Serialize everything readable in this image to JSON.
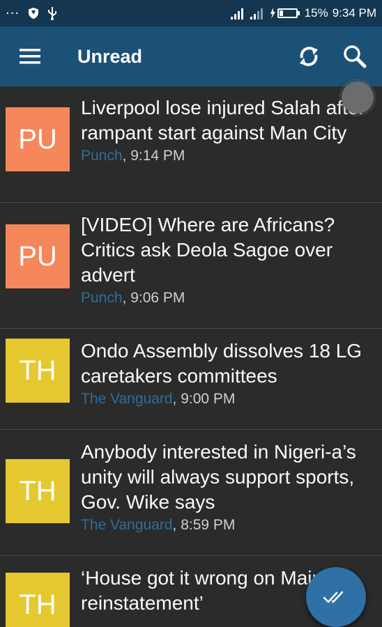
{
  "status_bar": {
    "battery": "15%",
    "time": "9:34 PM"
  },
  "app_bar": {
    "title": "Unread"
  },
  "articles": [
    {
      "avatar": "PU",
      "avatar_color": "#f5875a",
      "headline": "Liverpool lose injured Salah after rampant start against Man City",
      "source": "Punch",
      "time": ", 9:14 PM"
    },
    {
      "avatar": "PU",
      "avatar_color": "#f5875a",
      "headline": "[VIDEO] Where are Africans? Critics ask Deola Sagoe over advert",
      "source": "Punch",
      "time": ", 9:06 PM"
    },
    {
      "avatar": "TH",
      "avatar_color": "#e5c830",
      "headline": "Ondo Assembly dissolves 18 LG caretakers committees",
      "source": "The Vanguard",
      "time": ", 9:00 PM"
    },
    {
      "avatar": "TH",
      "avatar_color": "#e5c830",
      "headline": "Anybody interested in Nigeri-a’s unity will always support sports, Gov. Wike says",
      "source": "The Vanguard",
      "time": ", 8:59 PM"
    },
    {
      "avatar": "TH",
      "avatar_color": "#e5c830",
      "headline": "‘House got it wrong on Maina’s reinstatement’",
      "source": "",
      "time": ""
    }
  ],
  "icons": {
    "menu": "menu-icon",
    "refresh": "refresh-icon",
    "search": "search-icon",
    "mark_all_read": "double-check-icon"
  }
}
